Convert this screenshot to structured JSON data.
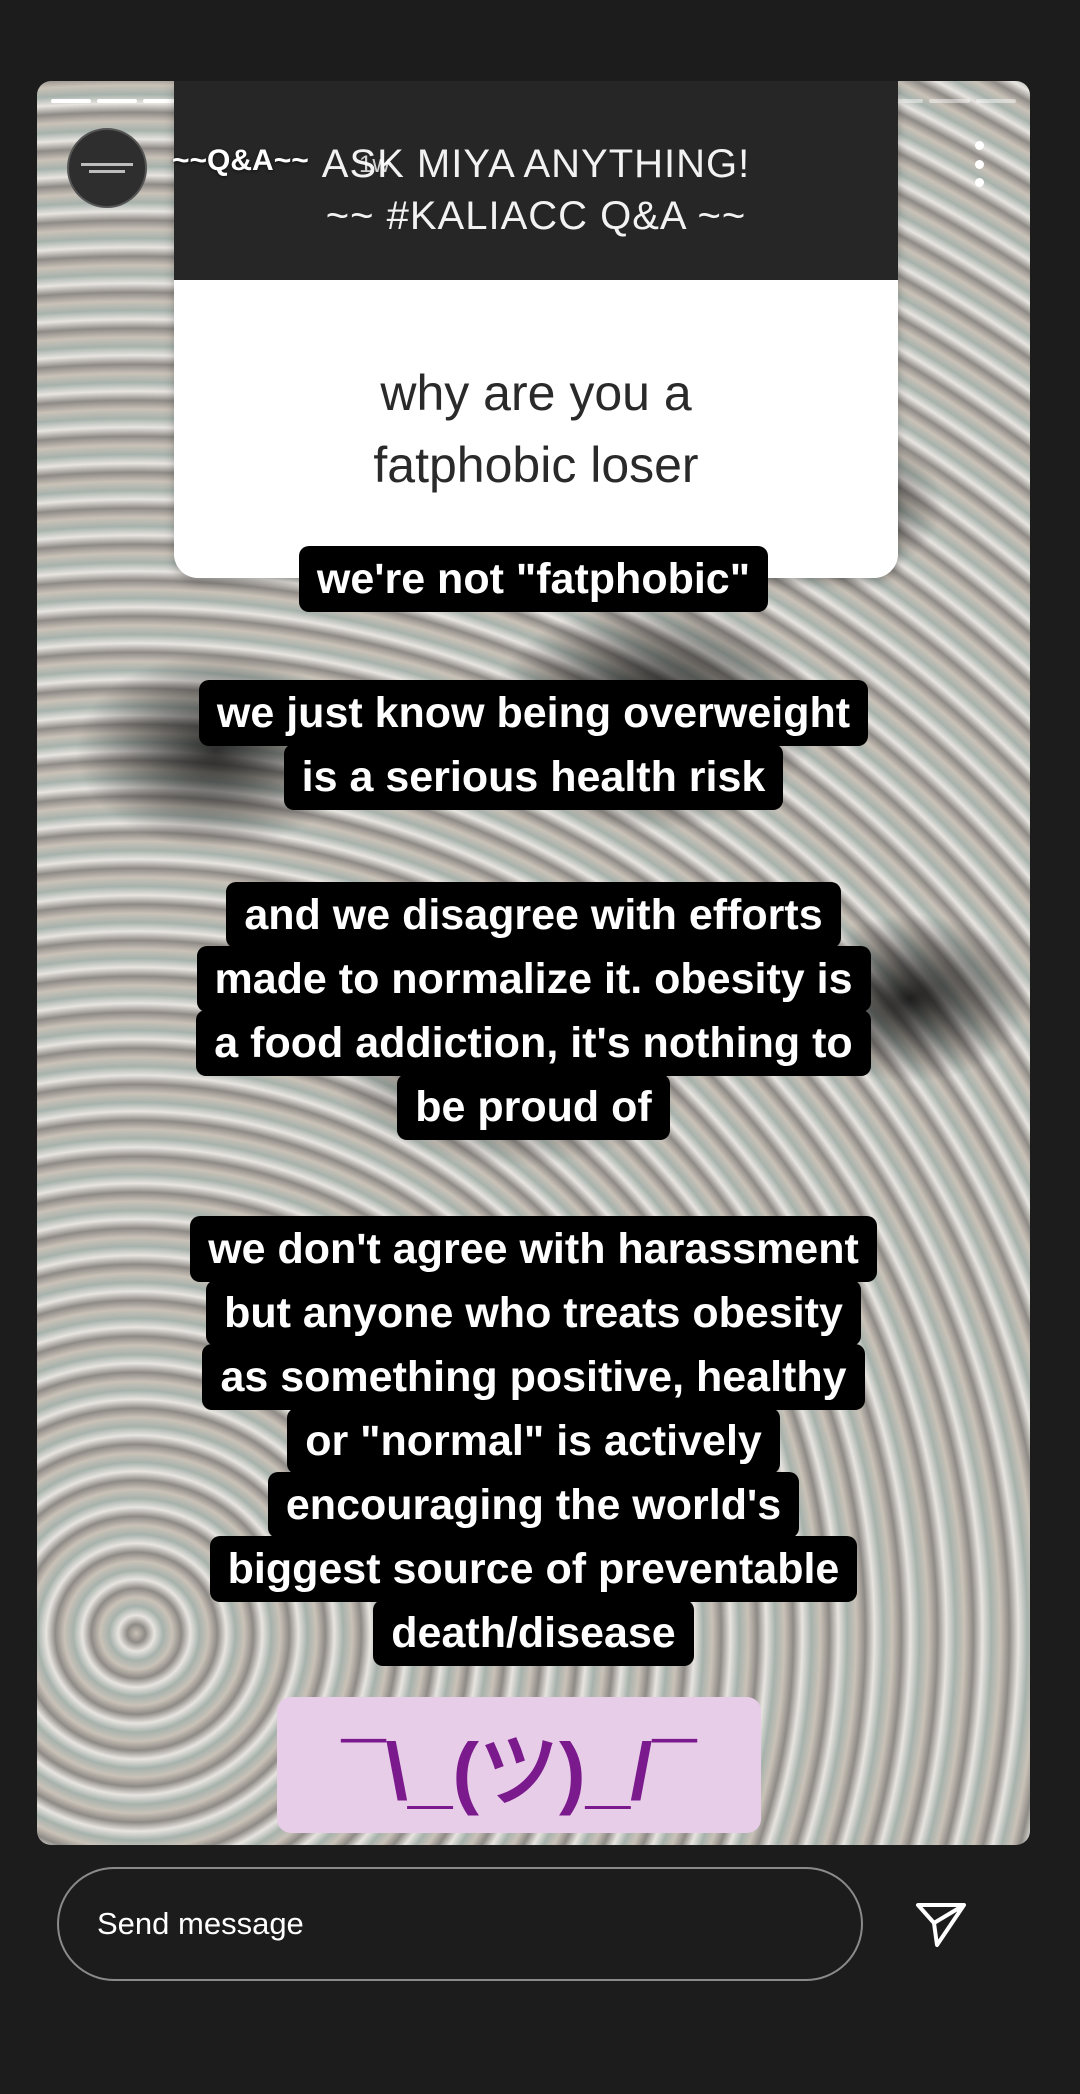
{
  "story": {
    "progress_total": 21,
    "progress_done": 12,
    "username": "~~Q&A~~",
    "time_ago": "1w",
    "avatar_lines": [
      "ASK MIYA ANYTHING!",
      "~~ #KALIACC Q&A ~~"
    ]
  },
  "question_box": {
    "header_line1": "ASK MIYA ANYTHING!",
    "header_line2": "~~ #KALIACC Q&A ~~",
    "question_line1": "why are you a",
    "question_line2": "fatphobic loser"
  },
  "captions": {
    "block1": [
      "we're not \"fatphobic\""
    ],
    "block2": [
      "we just know being overweight",
      "is a serious health risk"
    ],
    "block3": [
      "and we disagree with efforts",
      "made to normalize it. obesity is",
      "a food addiction, it's nothing to",
      "be proud of"
    ],
    "block4": [
      "we don't agree with harassment",
      "but anyone who treats obesity",
      "as something positive, healthy",
      "or \"normal\" is actively",
      "encouraging the world's",
      "biggest source of preventable",
      "death/disease"
    ]
  },
  "sticker": {
    "text": "¯\\_(ツ)_/¯",
    "background": "#e8cde9",
    "color": "#7a1a8c"
  },
  "footer": {
    "send_placeholder": "Send message"
  },
  "icons": {
    "more": "more-vertical-icon",
    "send": "send-icon"
  }
}
